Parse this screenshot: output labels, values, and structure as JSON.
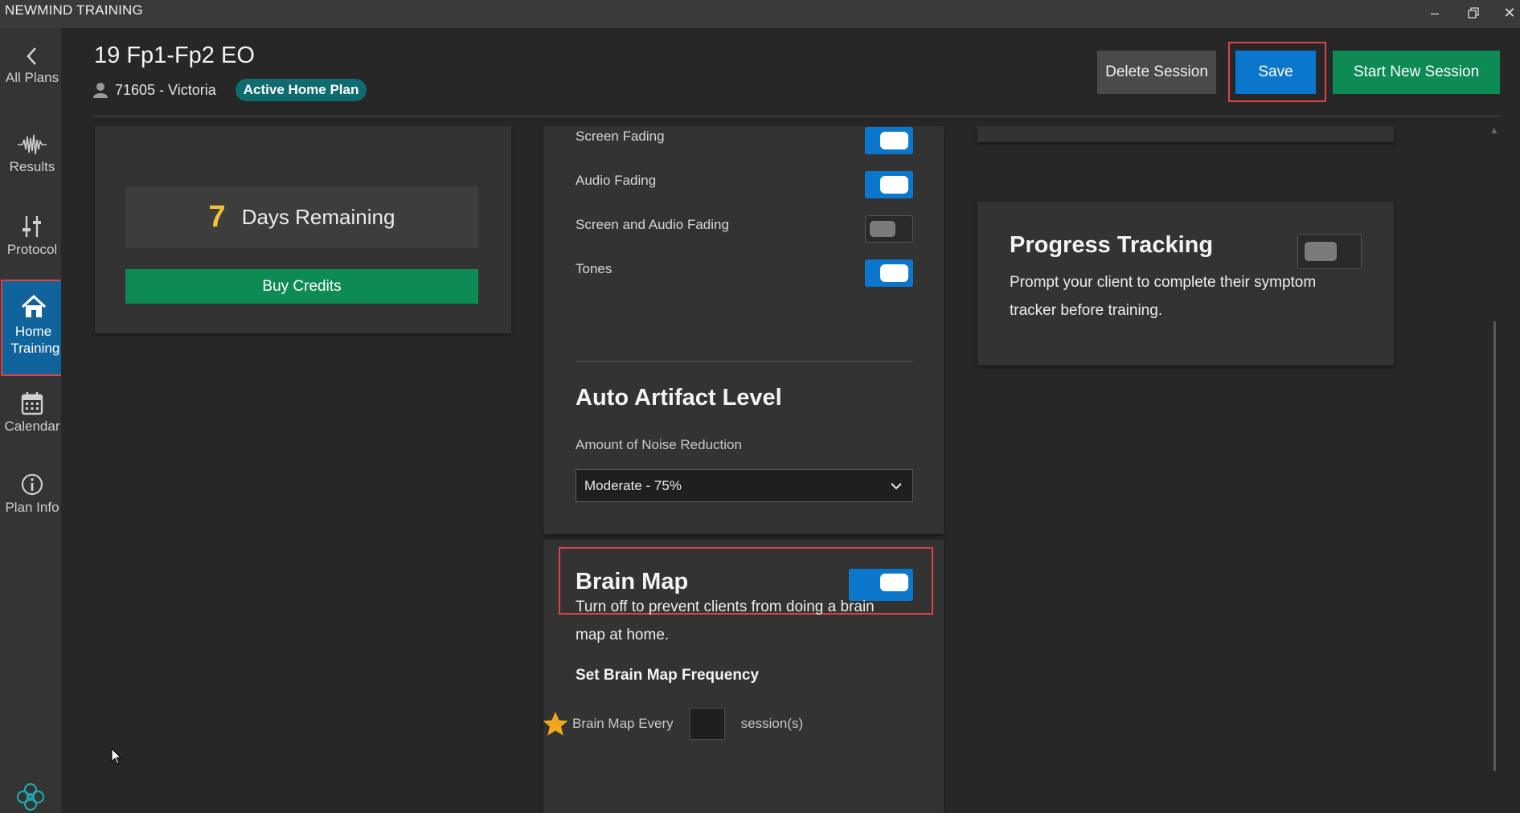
{
  "window": {
    "title": "NEWMIND TRAINING",
    "controls": [
      "minimize",
      "restore",
      "close"
    ]
  },
  "sidebar": {
    "items": [
      {
        "label": "All Plans",
        "icon": "chevron-left-icon"
      },
      {
        "label": "Results",
        "icon": "waveform-icon"
      },
      {
        "label": "Protocol",
        "icon": "sliders-icon"
      },
      {
        "label": "Home Training",
        "icon": "home-icon",
        "active": true
      },
      {
        "label": "Calendar",
        "icon": "calendar-icon"
      },
      {
        "label": "Plan Info",
        "icon": "info-icon"
      }
    ],
    "logo_icon": "newmind-logo-icon"
  },
  "header": {
    "plan_title": "19 Fp1-Fp2 EO",
    "client": "71605 - Victoria",
    "badge": "Active Home Plan",
    "buttons": {
      "delete": "Delete Session",
      "save": "Save",
      "start": "Start New Session"
    }
  },
  "credits": {
    "days_number": "7",
    "days_label": "Days Remaining",
    "buy_label": "Buy Credits"
  },
  "feedback": {
    "toggles": [
      {
        "label": "Screen Fading",
        "on": true
      },
      {
        "label": "Audio Fading",
        "on": true
      },
      {
        "label": "Screen and Audio Fading",
        "on": false
      },
      {
        "label": "Tones",
        "on": true
      }
    ]
  },
  "artifact": {
    "heading": "Auto Artifact Level",
    "field_label": "Amount of Noise Reduction",
    "selected": "Moderate - 75%"
  },
  "brain_map": {
    "heading": "Brain Map",
    "enabled": true,
    "description": "Turn off to prevent clients from doing a brain map at home.",
    "frequency_heading": "Set Brain Map Frequency",
    "every_label": "Brain Map Every",
    "value": "",
    "unit": "session(s)"
  },
  "progress": {
    "heading": "Progress Tracking",
    "enabled": false,
    "description": "Prompt your client to complete their symptom tracker before training."
  },
  "colors": {
    "accent_blue": "#0b77cc",
    "accent_green": "#0e8a55",
    "badge_teal": "#0e6b70",
    "highlight_red": "#d94545",
    "days_yellow": "#f2c232"
  }
}
